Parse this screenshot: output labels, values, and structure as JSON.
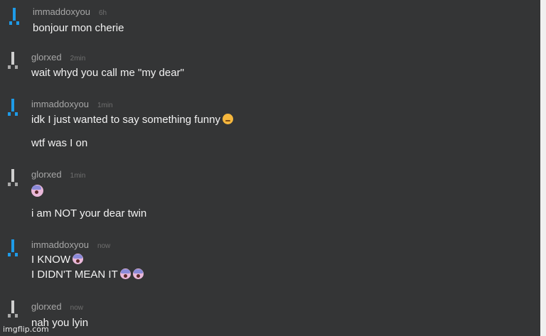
{
  "messages": [
    {
      "user": "immaddoxyou",
      "time": "6h",
      "lines": [
        "bonjour mon cherie"
      ]
    },
    {
      "user": "glorxed",
      "time": "2min",
      "lines": [
        "wait whyd you call me \"my dear\""
      ]
    },
    {
      "user": "immaddoxyou",
      "time": "1min",
      "lines": [
        "idk I just wanted to say something funny",
        "wtf was I on"
      ]
    },
    {
      "user": "glorxed",
      "time": "1min",
      "lines": [
        "i am NOT your dear twin"
      ]
    },
    {
      "user": "immaddoxyou",
      "time": "now",
      "lines": [
        "I KNOW",
        "I DIDN'T MEAN IT"
      ]
    },
    {
      "user": "glorxed",
      "time": "now",
      "lines": [
        "nah you lyin"
      ]
    }
  ],
  "watermark": "imgflip.com",
  "colors": {
    "background": "#343536",
    "username": "#a7a7a7",
    "timestamp": "#6f6f6f",
    "text": "#f2f2f2",
    "accent_blue": "#1e9be8"
  },
  "emoji": {
    "pensive": "pensive-face-icon",
    "scream": "face-screaming-icon"
  }
}
